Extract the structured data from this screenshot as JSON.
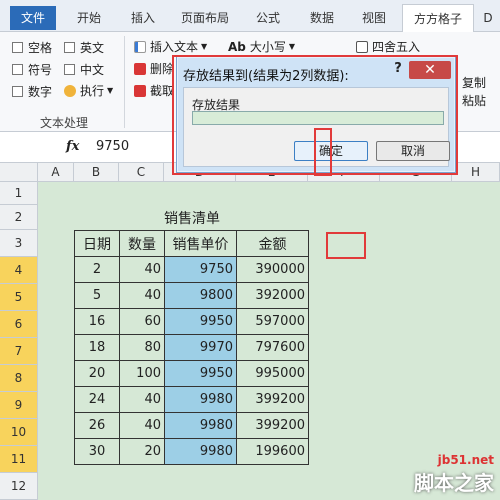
{
  "tabs": [
    "文件",
    "开始",
    "插入",
    "页面布局",
    "公式",
    "数据",
    "视图",
    "方方格子",
    "D"
  ],
  "ribbon": {
    "checkboxes": [
      "空格",
      "英文",
      "符号",
      "中文",
      "数字"
    ],
    "exec_label": "执行",
    "insert_text": "插入文本",
    "case_label": "大小写",
    "delete_label": "删除",
    "cut_label": "截取",
    "round_label": "四舍五入",
    "copy_label": "复制",
    "paste_label": "粘贴",
    "group_label": "文本处理"
  },
  "formula_bar": {
    "fx": "fx",
    "value": "9750"
  },
  "sheet": {
    "columns": [
      "A",
      "B",
      "C",
      "D",
      "E",
      "F",
      "G",
      "H"
    ],
    "rows": [
      "1",
      "2",
      "3",
      "4",
      "5",
      "6",
      "7",
      "8",
      "9",
      "10",
      "11",
      "12"
    ],
    "title": "销售清单",
    "headers": [
      "日期",
      "数量",
      "销售单价",
      "金额"
    ],
    "data": [
      [
        "2",
        "40",
        "9750",
        "390000"
      ],
      [
        "5",
        "40",
        "9800",
        "392000"
      ],
      [
        "16",
        "60",
        "9950",
        "597000"
      ],
      [
        "18",
        "80",
        "9970",
        "797600"
      ],
      [
        "20",
        "100",
        "9950",
        "995000"
      ],
      [
        "24",
        "40",
        "9980",
        "399200"
      ],
      [
        "26",
        "40",
        "9980",
        "399200"
      ],
      [
        "30",
        "20",
        "9980",
        "199600"
      ]
    ]
  },
  "dialog": {
    "title": "存放结果到(结果为2列数据):",
    "help": "?",
    "close": "✕",
    "label": "存放结果",
    "ok": "确定",
    "cancel": "取消"
  },
  "watermark": {
    "site": "jb51.net",
    "brand": "脚本之家"
  }
}
